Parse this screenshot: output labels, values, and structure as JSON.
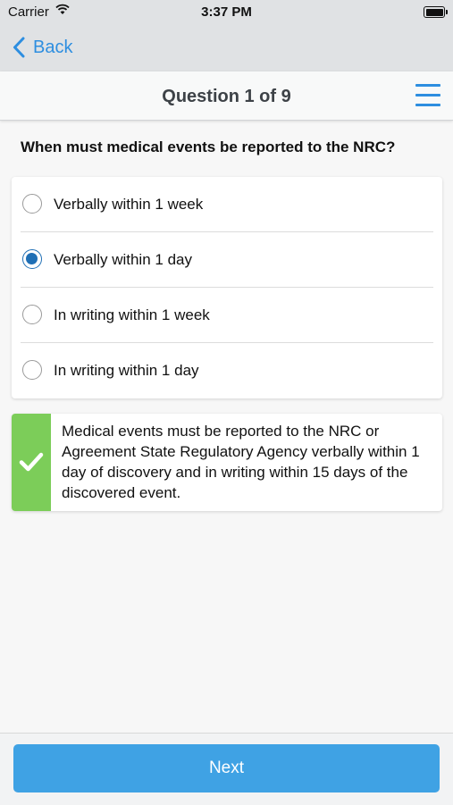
{
  "status_bar": {
    "carrier": "Carrier",
    "time": "3:37 PM"
  },
  "nav": {
    "back_label": "Back"
  },
  "header": {
    "title": "Question 1 of 9"
  },
  "question": {
    "text": "When must medical events be reported to the NRC?"
  },
  "options": [
    {
      "label": "Verbally within 1 week",
      "selected": false
    },
    {
      "label": "Verbally within 1 day",
      "selected": true
    },
    {
      "label": "In writing within 1 week",
      "selected": false
    },
    {
      "label": "In writing within 1 day",
      "selected": false
    }
  ],
  "explanation": {
    "text": "Medical events must be reported to the NRC or Agreement State Regulatory Agency verbally within 1 day of discovery and in writing within 15 days of the discovered event.",
    "status_icon": "checkmark-icon",
    "status_color": "#7ccd59"
  },
  "footer": {
    "next_label": "Next"
  },
  "colors": {
    "accent": "#2d8ee0",
    "selected_radio": "#1f6fb5",
    "next_button": "#3fa2e4"
  }
}
